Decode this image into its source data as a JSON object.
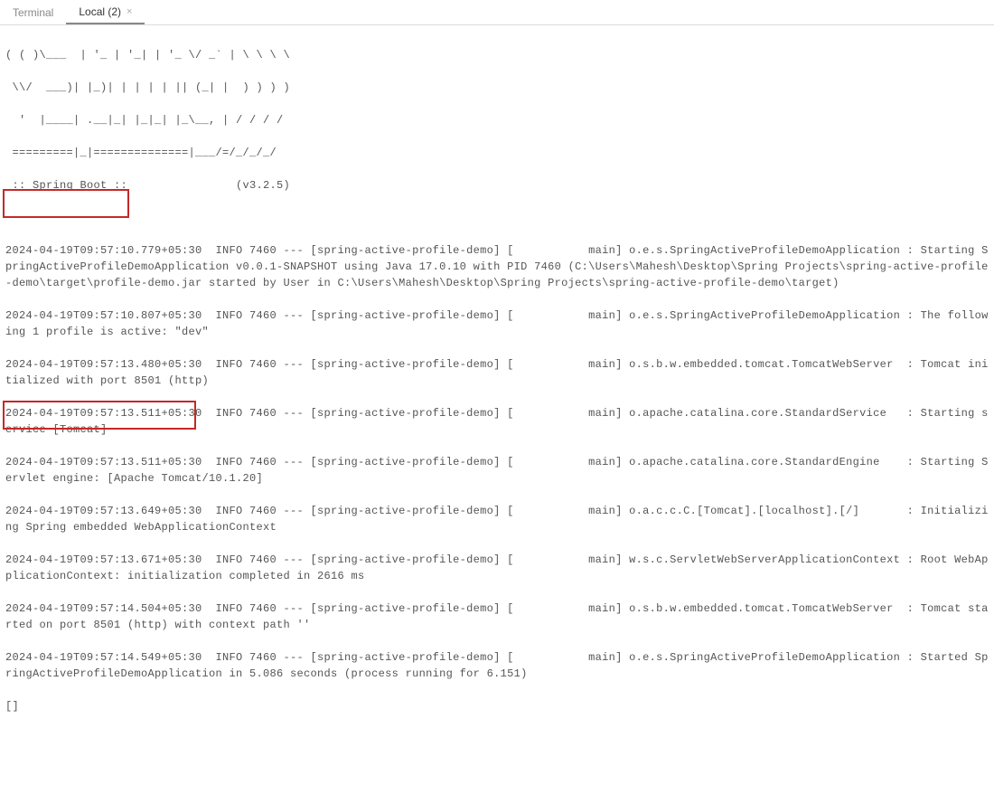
{
  "tabs": {
    "t0": "Terminal",
    "t1": "Local (2)"
  },
  "close_x": "×",
  "banner": {
    "b0": "( ( )\\___  | '_ | '_| | '_ \\/ _` | \\ \\ \\ \\",
    "b1": " \\\\/  ___)| |_)| | | | | || (_| |  ) ) ) )",
    "b2": "  '  |____| .__|_| |_|_| |_\\__, | / / / /",
    "b3": " =========|_|==============|___/=/_/_/_/",
    "b4": " :: Spring Boot ::                (v3.2.5)"
  },
  "log": {
    "l0": "2024-04-19T09:57:10.779+05:30  INFO 7460 --- [spring-active-profile-demo] [           main] o.e.s.SpringActiveProfileDemoApplication : Starting SpringActiveProfileDemoApplication v0.0.1-SNAPSHOT using Java 17.0.10 with PID 7460 (C:\\Users\\Mahesh\\Desktop\\Spring Projects\\spring-active-profile-demo\\target\\profile-demo.jar started by User in C:\\Users\\Mahesh\\Desktop\\Spring Projects\\spring-active-profile-demo\\target)",
    "l1": "2024-04-19T09:57:10.807+05:30  INFO 7460 --- [spring-active-profile-demo] [           main] o.e.s.SpringActiveProfileDemoApplication : The following 1 profile is active: \"dev\"",
    "l2": "2024-04-19T09:57:13.480+05:30  INFO 7460 --- [spring-active-profile-demo] [           main] o.s.b.w.embedded.tomcat.TomcatWebServer  : Tomcat initialized with port 8501 (http)",
    "l3": "2024-04-19T09:57:13.511+05:30  INFO 7460 --- [spring-active-profile-demo] [           main] o.apache.catalina.core.StandardService   : Starting service [Tomcat]",
    "l4": "2024-04-19T09:57:13.511+05:30  INFO 7460 --- [spring-active-profile-demo] [           main] o.apache.catalina.core.StandardEngine    : Starting Servlet engine: [Apache Tomcat/10.1.20]",
    "l5": "2024-04-19T09:57:13.649+05:30  INFO 7460 --- [spring-active-profile-demo] [           main] o.a.c.c.C.[Tomcat].[localhost].[/]       : Initializing Spring embedded WebApplicationContext",
    "l6": "2024-04-19T09:57:13.671+05:30  INFO 7460 --- [spring-active-profile-demo] [           main] w.s.c.ServletWebServerApplicationContext : Root WebApplicationContext: initialization completed in 2616 ms",
    "l7": "2024-04-19T09:57:14.504+05:30  INFO 7460 --- [spring-active-profile-demo] [           main] o.s.b.w.embedded.tomcat.TomcatWebServer  : Tomcat started on port 8501 (http) with context path ''",
    "l8": "2024-04-19T09:57:14.549+05:30  INFO 7460 --- [spring-active-profile-demo] [           main] o.e.s.SpringActiveProfileDemoApplication : Started SpringActiveProfileDemoApplication in 5.086 seconds (process running for 6.151)"
  },
  "cursor": "[]"
}
